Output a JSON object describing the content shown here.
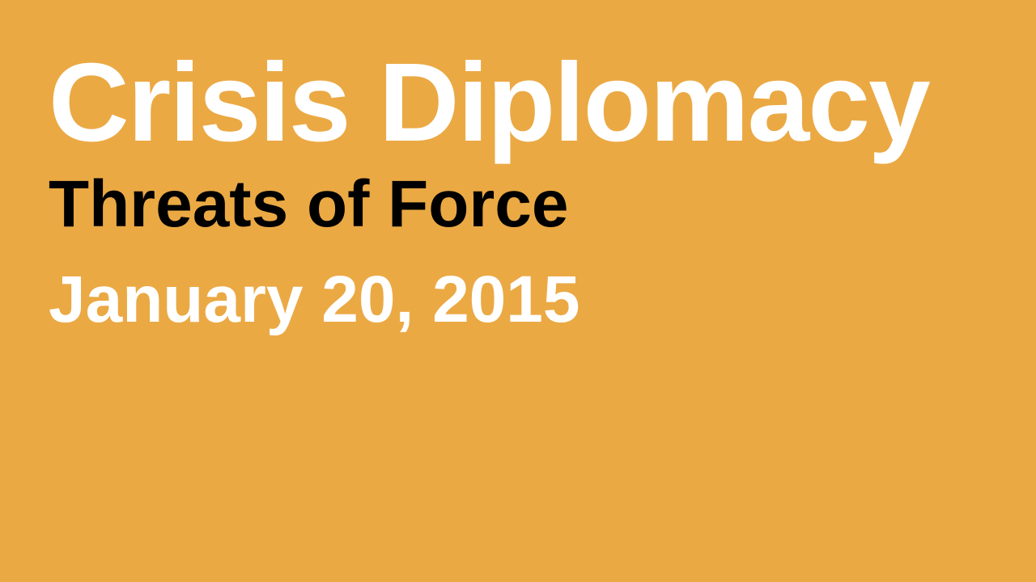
{
  "slide": {
    "title": "Crisis Diplomacy",
    "subtitle": "Threats of Force",
    "date": "January 20, 2015"
  },
  "colors": {
    "background": "#EBA944",
    "title": "#FFFFFF",
    "subtitle": "#000000",
    "date": "#FFFFFF"
  }
}
